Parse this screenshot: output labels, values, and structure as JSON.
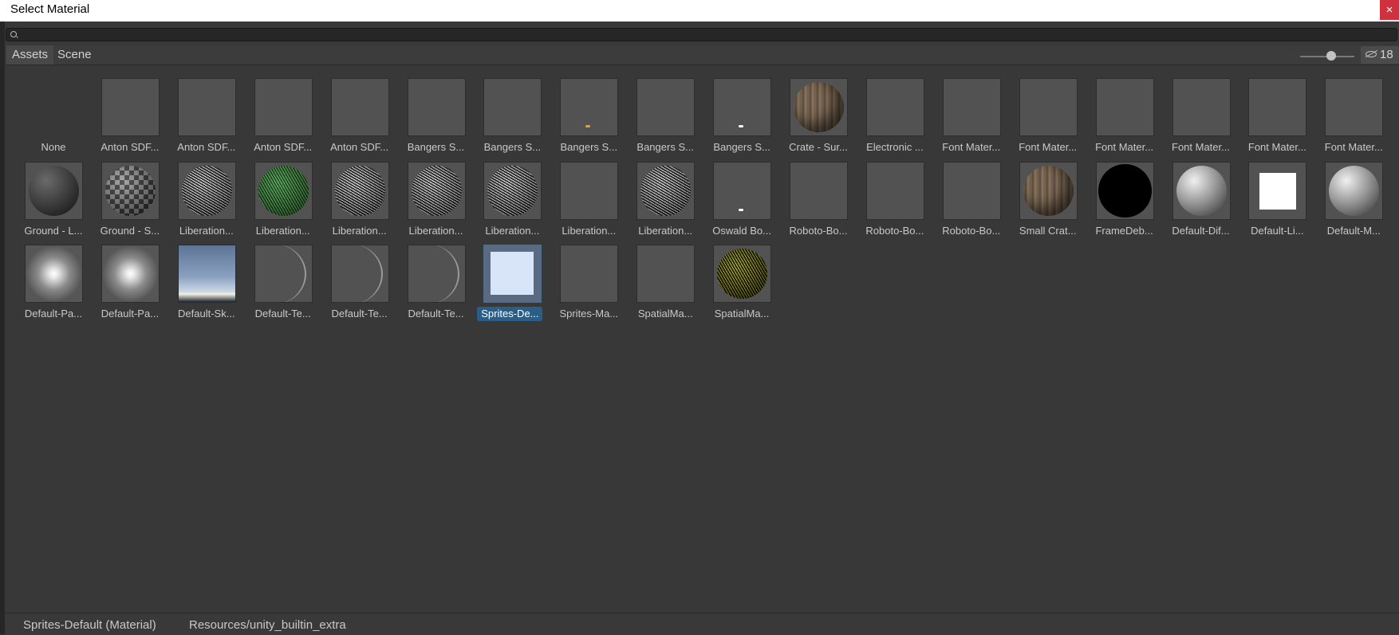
{
  "window": {
    "title": "Select Material",
    "close_glyph": "×"
  },
  "search": {
    "value": "",
    "placeholder": ""
  },
  "tabs": [
    {
      "label": "Assets",
      "active": true
    },
    {
      "label": "Scene",
      "active": false
    }
  ],
  "zoom_slider": {
    "value_fraction": 0.55
  },
  "hidden_count": "18",
  "items": [
    {
      "label": "None",
      "thumb": "none"
    },
    {
      "label": "Anton SDF...",
      "thumb": "empty"
    },
    {
      "label": "Anton SDF...",
      "thumb": "empty"
    },
    {
      "label": "Anton SDF...",
      "thumb": "empty"
    },
    {
      "label": "Anton SDF...",
      "thumb": "empty"
    },
    {
      "label": "Bangers S...",
      "thumb": "empty"
    },
    {
      "label": "Bangers S...",
      "thumb": "empty"
    },
    {
      "label": "Bangers S...",
      "thumb": "dot-orange"
    },
    {
      "label": "Bangers S...",
      "thumb": "empty"
    },
    {
      "label": "Bangers S...",
      "thumb": "dot-white"
    },
    {
      "label": "Crate - Sur...",
      "thumb": "wood-sphere"
    },
    {
      "label": "Electronic ...",
      "thumb": "empty"
    },
    {
      "label": "Font Mater...",
      "thumb": "empty"
    },
    {
      "label": "Font Mater...",
      "thumb": "empty"
    },
    {
      "label": "Font Mater...",
      "thumb": "empty"
    },
    {
      "label": "Font Mater...",
      "thumb": "empty"
    },
    {
      "label": "Font Mater...",
      "thumb": "empty"
    },
    {
      "label": "Font Mater...",
      "thumb": "empty"
    },
    {
      "label": "Ground - L...",
      "thumb": "dark-sphere"
    },
    {
      "label": "Ground - S...",
      "thumb": "check-sphere"
    },
    {
      "label": "Liberation...",
      "thumb": "text-sphere"
    },
    {
      "label": "Liberation...",
      "thumb": "green-sphere"
    },
    {
      "label": "Liberation...",
      "thumb": "text-sphere"
    },
    {
      "label": "Liberation...",
      "thumb": "text-sphere"
    },
    {
      "label": "Liberation...",
      "thumb": "text-sphere"
    },
    {
      "label": "Liberation...",
      "thumb": "empty"
    },
    {
      "label": "Liberation...",
      "thumb": "text-sphere"
    },
    {
      "label": "Oswald Bo...",
      "thumb": "dot-white"
    },
    {
      "label": "Roboto-Bo...",
      "thumb": "empty"
    },
    {
      "label": "Roboto-Bo...",
      "thumb": "empty"
    },
    {
      "label": "Roboto-Bo...",
      "thumb": "empty"
    },
    {
      "label": "Small Crat...",
      "thumb": "wood-sphere"
    },
    {
      "label": "FrameDeb...",
      "thumb": "black-sphere"
    },
    {
      "label": "Default-Dif...",
      "thumb": "gray-sphere"
    },
    {
      "label": "Default-Li...",
      "thumb": "white-square"
    },
    {
      "label": "Default-M...",
      "thumb": "gray-sphere"
    },
    {
      "label": "Default-Pa...",
      "thumb": "glow"
    },
    {
      "label": "Default-Pa...",
      "thumb": "glow"
    },
    {
      "label": "Default-Sk...",
      "thumb": "sky"
    },
    {
      "label": "Default-Te...",
      "thumb": "crescent"
    },
    {
      "label": "Default-Te...",
      "thumb": "crescent"
    },
    {
      "label": "Default-Te...",
      "thumb": "crescent"
    },
    {
      "label": "Sprites-De...",
      "thumb": "light-square",
      "selected": true
    },
    {
      "label": "Sprites-Ma...",
      "thumb": "empty"
    },
    {
      "label": "SpatialMa...",
      "thumb": "empty"
    },
    {
      "label": "SpatialMa...",
      "thumb": "yellow-sphere"
    }
  ],
  "status": {
    "name": "Sprites-Default (Material)",
    "path": "Resources/unity_builtin_extra"
  },
  "colors": {
    "background": "#383838",
    "selection": "#2c5d87",
    "close_button": "#d0313f"
  }
}
